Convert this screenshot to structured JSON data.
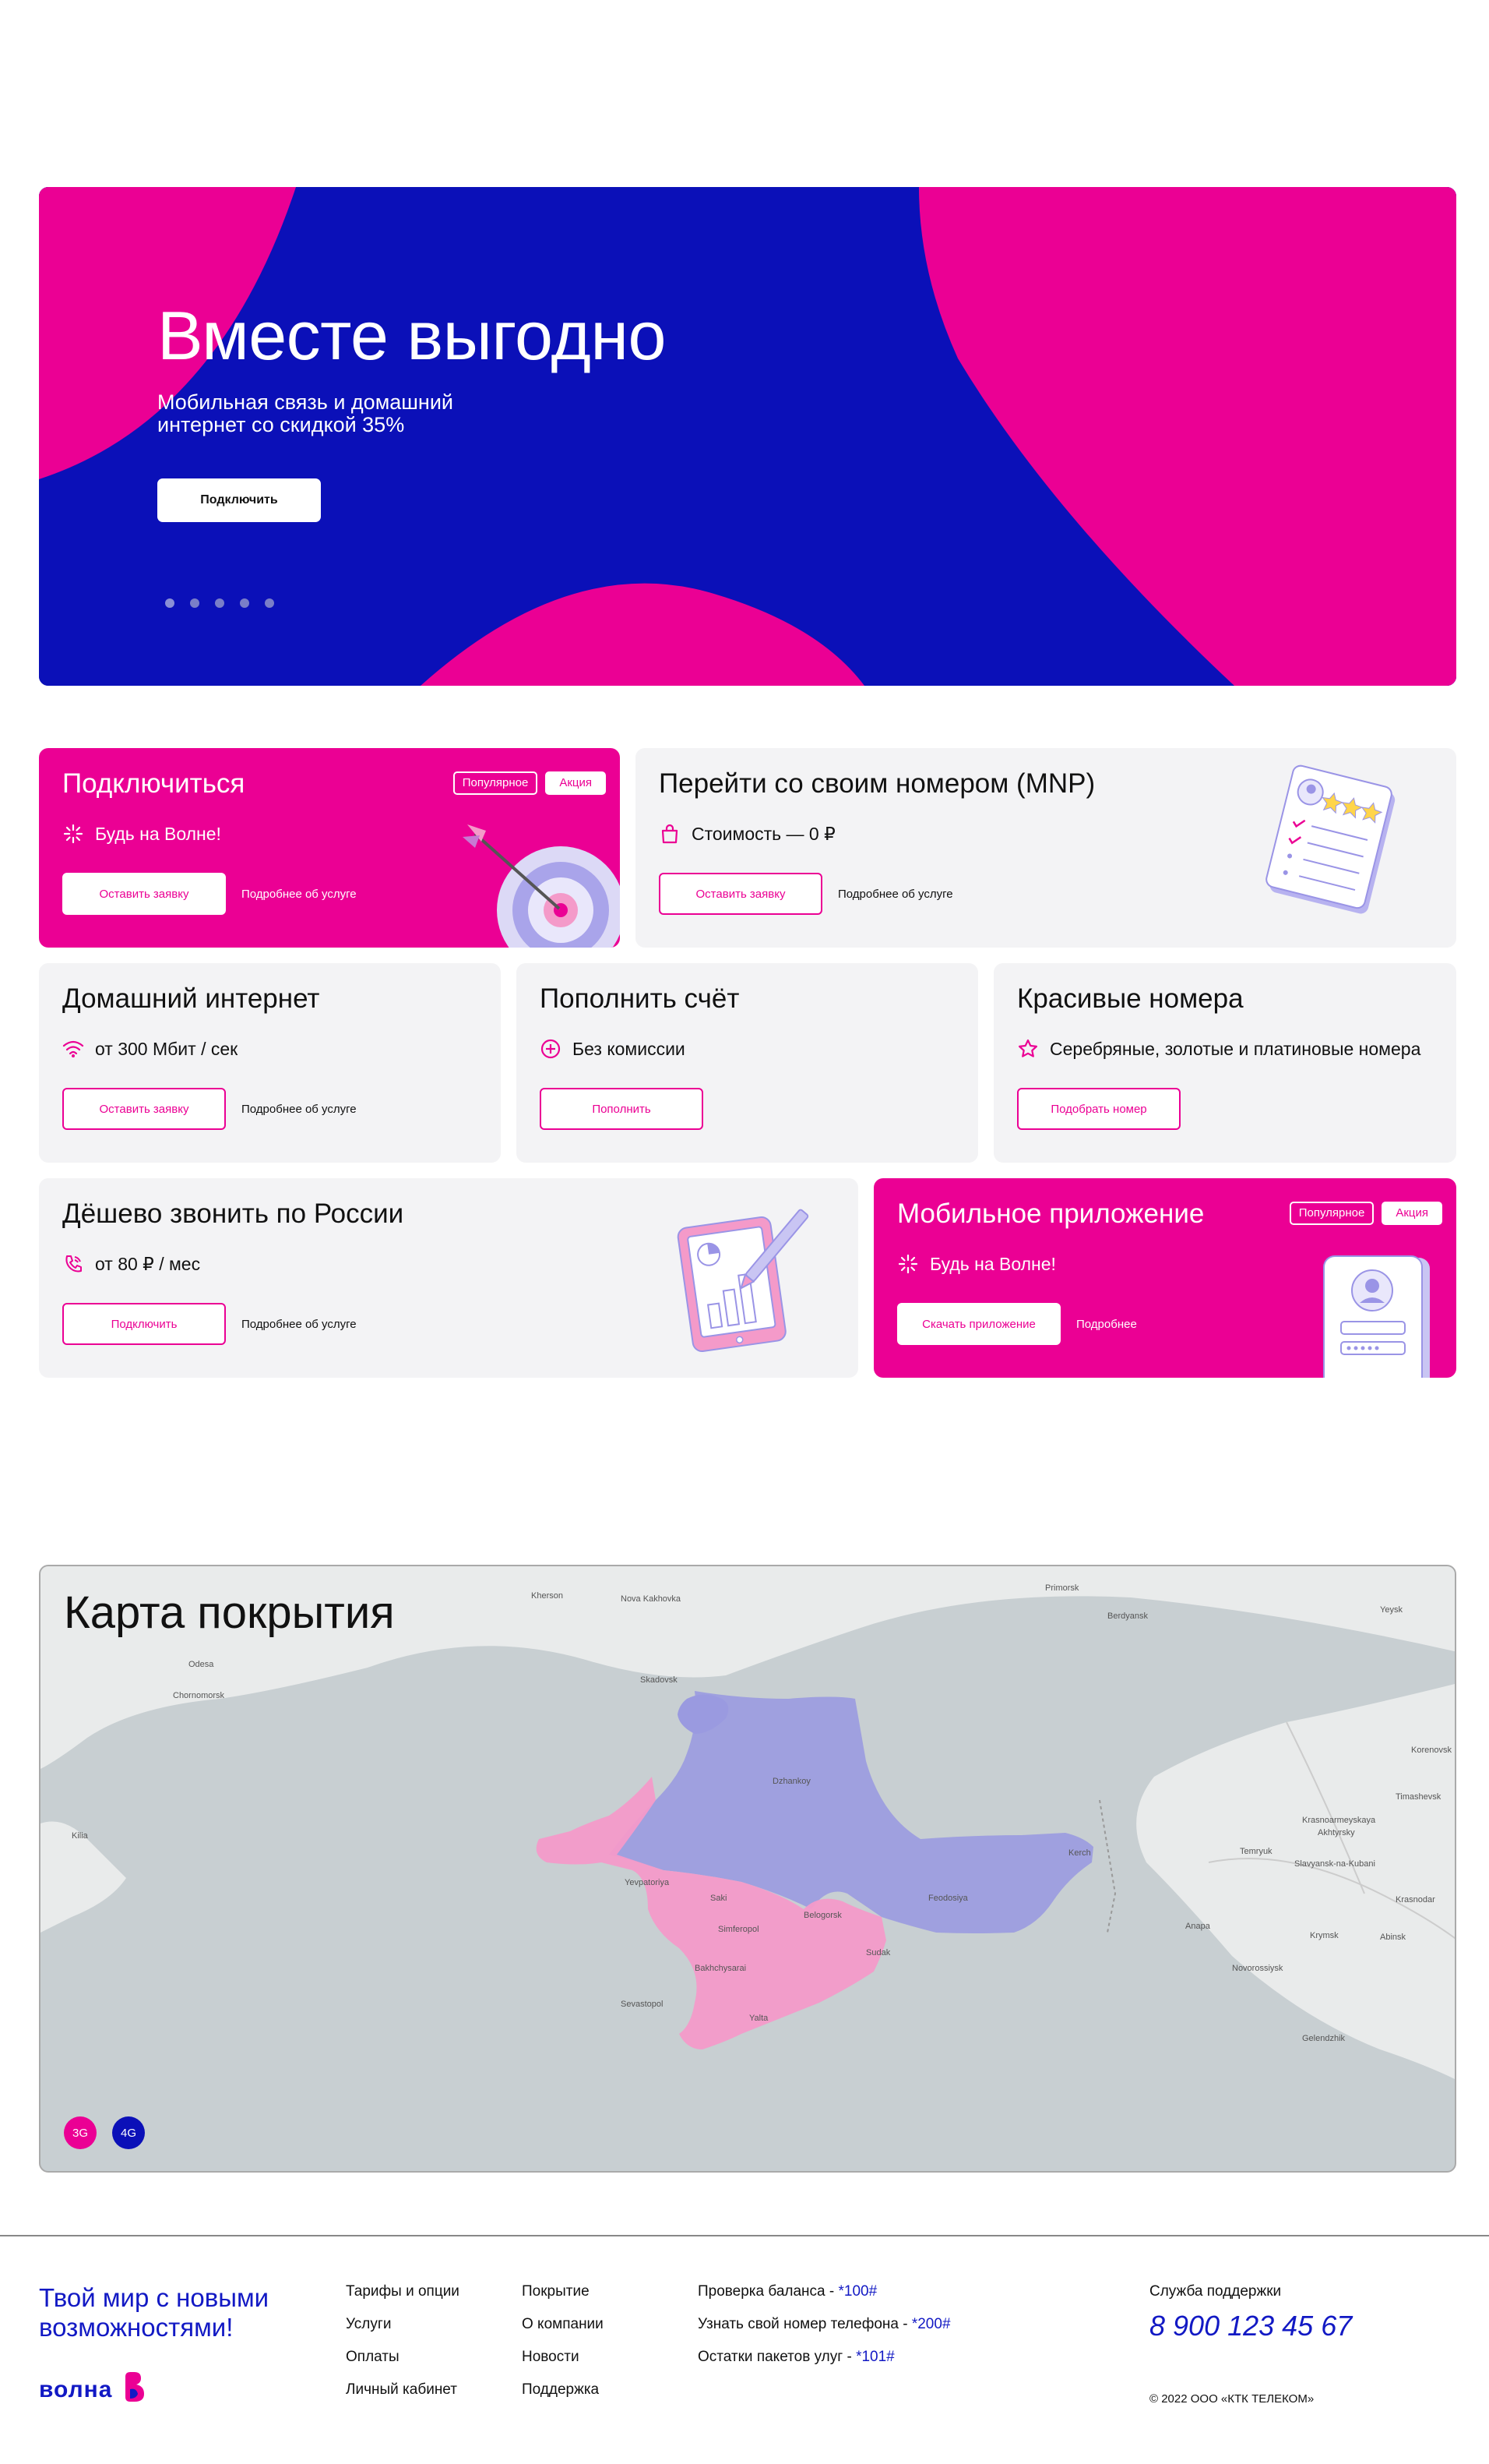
{
  "hero": {
    "title": "Вместе выгодно",
    "subtitle": "Мобильная связь и домашний интернет со скидкой 35%",
    "button": "Подключить",
    "slides": 5,
    "active_slide": 1
  },
  "cards": {
    "connect": {
      "title": "Подключиться",
      "badge_popular": "Популярное",
      "badge_promo": "Акция",
      "feature": "Будь на Волне!",
      "button": "Оставить заявку",
      "more": "Подробнее об услуге"
    },
    "mnp": {
      "title": "Перейти со своим номером (MNP)",
      "feature": "Стоимость — 0 ₽",
      "button": "Оставить заявку",
      "more": "Подробнее об услуге"
    },
    "internet": {
      "title": "Домашний интернет",
      "feature": "от 300 Мбит / сек",
      "button": "Оставить заявку",
      "more": "Подробнее об услуге"
    },
    "topup": {
      "title": "Пополнить счёт",
      "feature": "Без комиссии",
      "button": "Пополнить"
    },
    "numbers": {
      "title": "Красивые номера",
      "feature": "Серебряные, золотые и платиновые номера",
      "button": "Подобрать номер"
    },
    "calls": {
      "title": "Дёшево звонить по России",
      "feature": "от 80 ₽ / мес",
      "button": "Подключить",
      "more": "Подробнее об услуге"
    },
    "app": {
      "title": "Мобильное приложение",
      "badge_popular": "Популярное",
      "badge_promo": "Акция",
      "feature": "Будь на Волне!",
      "button": "Скачать приложение",
      "more": "Подробнее"
    }
  },
  "map": {
    "title": "Карта покрытия",
    "legend_3g": "3G",
    "legend_4g": "4G",
    "places": [
      "Nova Kakhovka",
      "Kherson",
      "Primorsk",
      "Berdyansk",
      "Skadovsk",
      "Dzhankoy",
      "Yevpatoriya",
      "Saki",
      "Simferopol",
      "Belogorsk",
      "Feodosiya",
      "Sudak",
      "Bakhchysarai",
      "Sevastopol",
      "Yalta",
      "Kerch",
      "Temryuk",
      "Slavyansk-na-Kubani",
      "Krasnodar",
      "Novorossiysk",
      "Anapa",
      "Krymsk",
      "Abinsk",
      "Yeysk",
      "Timashevsk",
      "Krasnoarmeyskaya",
      "Akhtyrsky",
      "Gelendzhik",
      "Korenovsk",
      "Kilia",
      "Odesa",
      "Chornomorsk"
    ],
    "colors": {
      "g3": "#eb0094",
      "g4": "#0b10b8",
      "zone_g3": "#f49ac9",
      "zone_g4": "#9a9ae0"
    }
  },
  "footer": {
    "slogan": "Твой мир с новыми возможностями!",
    "logo_text": "волна",
    "col1": [
      "Тарифы и опции",
      "Услуги",
      "Оплаты",
      "Личный кабинет"
    ],
    "col2": [
      "Покрытие",
      "О компании",
      "Новости",
      "Поддержка"
    ],
    "ussd": [
      {
        "label": "Проверка баланса - ",
        "code": "*100#"
      },
      {
        "label": "Узнать свой номер телефона - ",
        "code": "*200#"
      },
      {
        "label": "Остатки пакетов улуг - ",
        "code": "*101#"
      }
    ],
    "support_label": "Служба поддержки",
    "support_phone": "8 900 123 45 67",
    "copyright": "© 2022 ООО «КТК ТЕЛЕКОМ»"
  },
  "colors": {
    "brand_pink": "#eb0094",
    "brand_blue": "#0b10b8",
    "card_bg": "#f3f3f5"
  }
}
